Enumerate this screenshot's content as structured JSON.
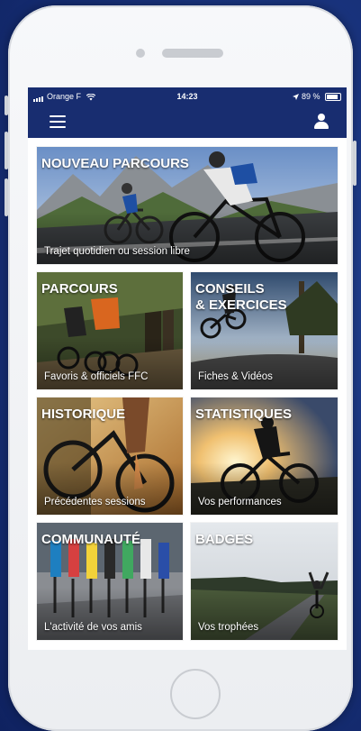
{
  "status_bar": {
    "carrier": "Orange F",
    "time": "14:23",
    "battery": "89 %"
  },
  "navbar": {
    "menu_icon": "hamburger-icon",
    "profile_icon": "user-icon"
  },
  "tiles": [
    {
      "title": "NOUVEAU PARCOURS",
      "subtitle": "Trajet quotidien ou session libre"
    },
    {
      "title": "PARCOURS",
      "subtitle": "Favoris & officiels FFC"
    },
    {
      "title": "CONSEILS\n& EXERCICES",
      "subtitle": "Fiches & Vidéos"
    },
    {
      "title": "HISTORIQUE",
      "subtitle": "Précédentes sessions"
    },
    {
      "title": "STATISTIQUES",
      "subtitle": "Vos performances"
    },
    {
      "title": "COMMUNAUTÉ",
      "subtitle": "L'activité de vos amis"
    },
    {
      "title": "BADGES",
      "subtitle": "Vos trophées"
    }
  ],
  "colors": {
    "background": "#1a3580",
    "nav": "#182d70",
    "tile_text": "#ffffff"
  }
}
